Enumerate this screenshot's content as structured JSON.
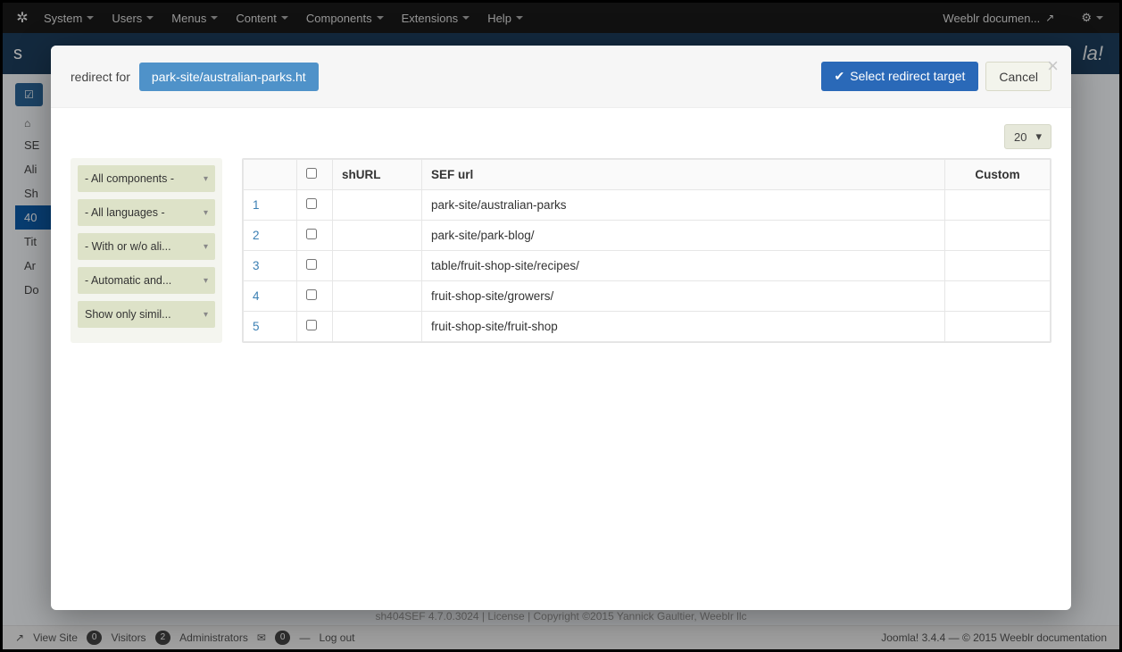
{
  "topbar": {
    "menus": [
      "System",
      "Users",
      "Menus",
      "Content",
      "Components",
      "Extensions",
      "Help"
    ],
    "right_label": "Weeblr documen...",
    "j_glyph": "✲"
  },
  "bluebar": {
    "title_visible": "s",
    "brand": "la!"
  },
  "sidebar_items": [
    "SE",
    "Ali",
    "Sh",
    "40",
    "Tit",
    "Ar",
    "Do"
  ],
  "sidebar_active_index": 3,
  "modal": {
    "header_prefix": "redirect for",
    "url": "park-site/australian-parks.ht",
    "select_btn": "Select redirect target",
    "cancel_btn": "Cancel",
    "pager_value": "20",
    "filters": [
      "- All components -",
      "- All languages -",
      "- With or w/o ali...",
      "- Automatic and...",
      "Show only simil..."
    ],
    "columns": {
      "num": "",
      "chk": "",
      "shurl": "shURL",
      "sef": "SEF url",
      "custom": "Custom"
    },
    "rows": [
      {
        "n": "1",
        "sef": "park-site/australian-parks"
      },
      {
        "n": "2",
        "sef": "park-site/park-blog/"
      },
      {
        "n": "3",
        "sef": "table/fruit-shop-site/recipes/"
      },
      {
        "n": "4",
        "sef": "fruit-shop-site/growers/"
      },
      {
        "n": "5",
        "sef": "fruit-shop-site/fruit-shop"
      }
    ]
  },
  "version_line": "sh404SEF 4.7.0.3024 | License | Copyright ©2015 Yannick Gaultier, Weeblr llc",
  "statusbar": {
    "view_site": "View Site",
    "visitors": {
      "count": "0",
      "label": "Visitors"
    },
    "admins": {
      "count": "2",
      "label": "Administrators"
    },
    "msgs": "0",
    "logout": "Log out",
    "right": "Joomla! 3.4.4  —  © 2015 Weeblr documentation"
  }
}
